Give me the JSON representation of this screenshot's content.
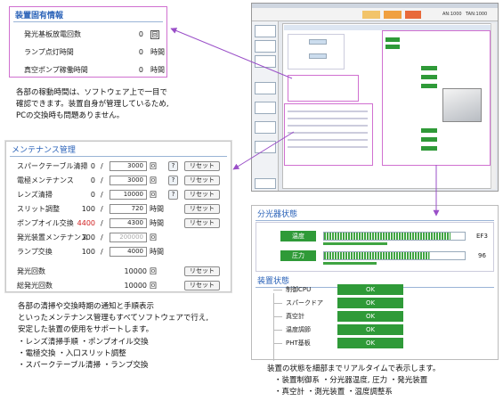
{
  "device_info": {
    "title": "装置固有情報",
    "rows": [
      {
        "label": "発光基板放電回数",
        "value": "0",
        "unit": "回"
      },
      {
        "label": "ランプ点灯時間",
        "value": "0",
        "unit": "時間"
      },
      {
        "label": "真空ポンプ稼働時間",
        "value": "0",
        "unit": "時間"
      }
    ]
  },
  "caption_top": [
    "各部の稼動時間は、ソフトウェア上で一目で",
    "確認できます。装置自身が管理しているため,",
    "PCの交換時も問題ありません。"
  ],
  "maintenance": {
    "title": "メンテナンス管理",
    "reset_label": "リセット",
    "help_label": "?",
    "rows": [
      {
        "label": "スパークテーブル清掃",
        "current": "0",
        "limit": "3000",
        "unit": "回",
        "help": true,
        "reset": true
      },
      {
        "label": "電極メンテナンス",
        "current": "0",
        "limit": "3000",
        "unit": "回",
        "help": true,
        "reset": true
      },
      {
        "label": "レンズ清掃",
        "current": "0",
        "limit": "10000",
        "unit": "回",
        "help": true,
        "reset": true
      },
      {
        "label": "スリット調整",
        "current": "100",
        "limit": "720",
        "unit": "時間",
        "help": false,
        "reset": true
      },
      {
        "label": "ポンプオイル交換",
        "current": "4400",
        "limit": "4300",
        "unit": "時間",
        "help": false,
        "reset": true
      },
      {
        "label": "発光装置メンテナンス",
        "current": "100",
        "limit": "200000",
        "unit": "回",
        "help": false,
        "reset": false
      },
      {
        "label": "ランプ交換",
        "current": "100",
        "limit": "4000",
        "unit": "時間",
        "help": false,
        "reset": false
      }
    ],
    "totals": [
      {
        "label": "発光回数",
        "value": "10000",
        "unit": "回"
      },
      {
        "label": "総発光回数",
        "value": "10000",
        "unit": "回"
      }
    ]
  },
  "caption_left": [
    "各部の清掃や交換時期の通知と手順表示",
    "といったメンテナンス管理もすべてソフトウェアで行え,",
    "安定した装置の使用をサポートします。",
    "・レンズ清掃手順  ・ポンプオイル交換",
    "・電極交換  ・入口スリット調整",
    "・スパークテーブル清掃  ・ランプ交換"
  ],
  "spectrometer": {
    "title": "分光器状態",
    "rows": [
      {
        "label": "温度",
        "value": "EF3",
        "fill": 0.9
      },
      {
        "label": "圧力",
        "value": "96",
        "fill": 0.75
      }
    ]
  },
  "device_status": {
    "title": "装置状態",
    "ok_label": "OK",
    "rows": [
      {
        "label": "制御CPU"
      },
      {
        "label": "スパークドア"
      },
      {
        "label": "真空計"
      },
      {
        "label": "温度調節"
      },
      {
        "label": "PHT基板"
      }
    ]
  },
  "caption_right": [
    "装置の状態を細部までリアルタイムで表示します。",
    "・装置制御系 ・分光器温度, 圧力 ・発光装置",
    "・真空計 ・測光装置 ・温度調整系"
  ],
  "screenshot": {
    "status_chip_1": "AN:1000",
    "status_chip_2": "TAN:1000",
    "accent_orange": "#f0a040",
    "accent_green": "#2f9a38"
  }
}
